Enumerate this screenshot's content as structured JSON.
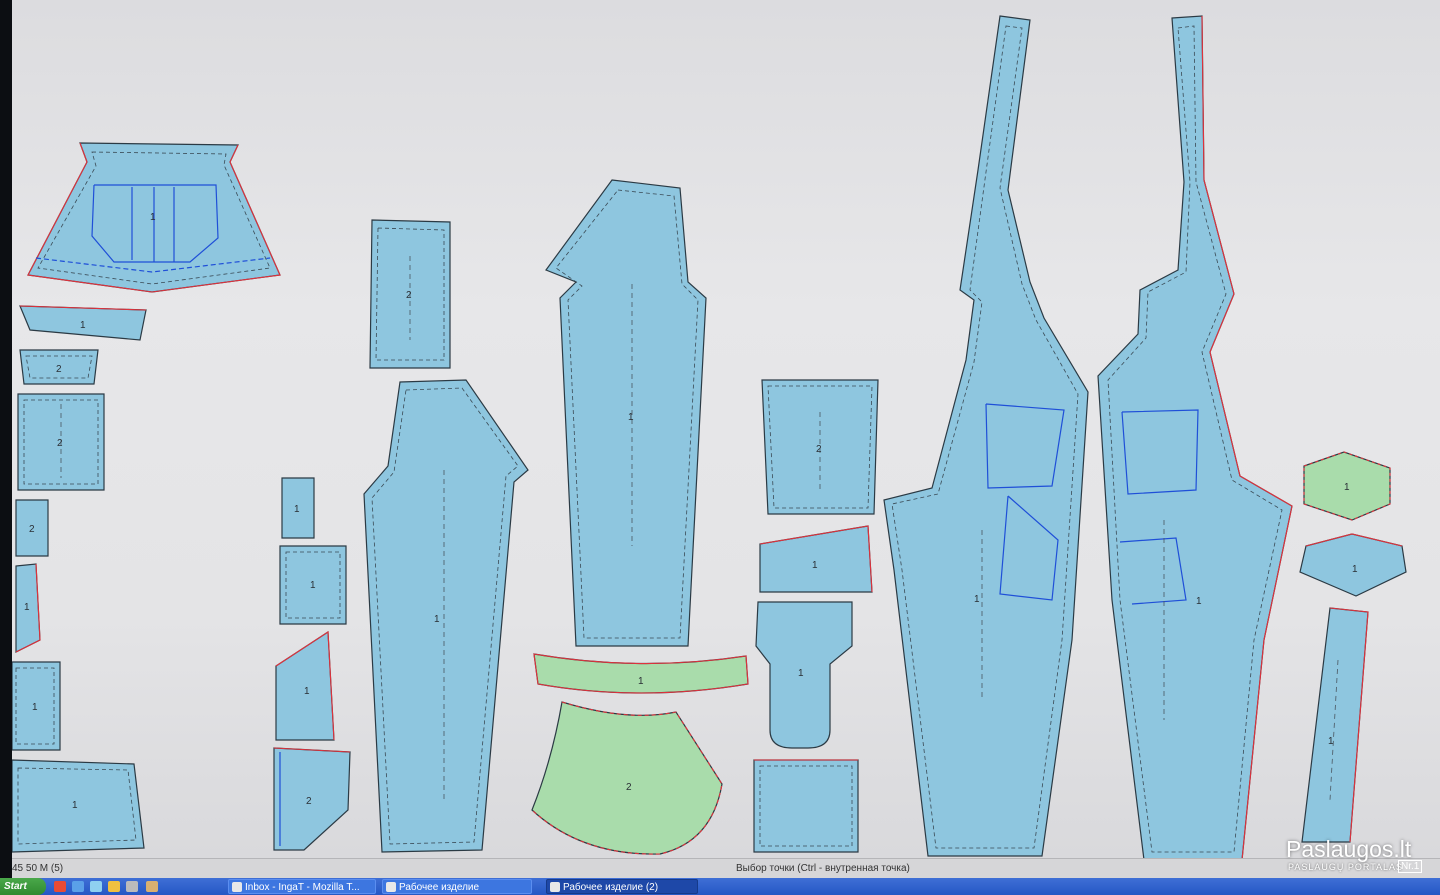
{
  "status_bar": {
    "left_text": "45  50 M (5)",
    "hint": "Выбор точки (Ctrl - внутренная точка)"
  },
  "taskbar": {
    "start_label": "Start",
    "tasks": [
      {
        "label": "Inbox - IngaT - Mozilla T..."
      },
      {
        "label": "Рабочее изделие"
      },
      {
        "label": "Рабочее изделие (2)"
      }
    ]
  },
  "watermark": {
    "logo": "Paslaugos.lt",
    "subtitle": "PASLAUGŲ PORTALAS",
    "badge": "Nr.1"
  },
  "pattern_pieces": [
    {
      "id": "yoke",
      "label": "1",
      "color": "blue"
    },
    {
      "id": "small-rect-a",
      "label": "1",
      "color": "blue"
    },
    {
      "id": "small-rect-b",
      "label": "2",
      "color": "blue"
    },
    {
      "id": "pocket-2",
      "label": "2",
      "color": "blue"
    },
    {
      "id": "strip-2",
      "label": "2",
      "color": "blue"
    },
    {
      "id": "strip-1",
      "label": "1",
      "color": "blue"
    },
    {
      "id": "rect-1",
      "label": "1",
      "color": "blue"
    },
    {
      "id": "bottom-1",
      "label": "1",
      "color": "blue"
    },
    {
      "id": "tall-rect-2",
      "label": "2",
      "color": "blue"
    },
    {
      "id": "tiny-1",
      "label": "1",
      "color": "blue"
    },
    {
      "id": "sq-1",
      "label": "1",
      "color": "blue"
    },
    {
      "id": "slant-1",
      "label": "1",
      "color": "blue"
    },
    {
      "id": "slant-2",
      "label": "2",
      "color": "blue"
    },
    {
      "id": "leg-a",
      "label": "1",
      "color": "blue"
    },
    {
      "id": "leg-b",
      "label": "1",
      "color": "blue"
    },
    {
      "id": "waistband",
      "label": "1",
      "color": "green"
    },
    {
      "id": "fan-2",
      "label": "2",
      "color": "green"
    },
    {
      "id": "pocket-bag-2",
      "label": "2",
      "color": "blue"
    },
    {
      "id": "trap-1",
      "label": "1",
      "color": "blue"
    },
    {
      "id": "fly-1",
      "label": "1",
      "color": "blue"
    },
    {
      "id": "base-1",
      "label": "",
      "color": "blue"
    },
    {
      "id": "front-left",
      "label": "1",
      "color": "blue"
    },
    {
      "id": "front-right",
      "label": "1",
      "color": "blue"
    },
    {
      "id": "hex-green",
      "label": "1",
      "color": "green"
    },
    {
      "id": "hex-blue",
      "label": "1",
      "color": "blue"
    },
    {
      "id": "long-strip",
      "label": "1",
      "color": "blue"
    }
  ]
}
